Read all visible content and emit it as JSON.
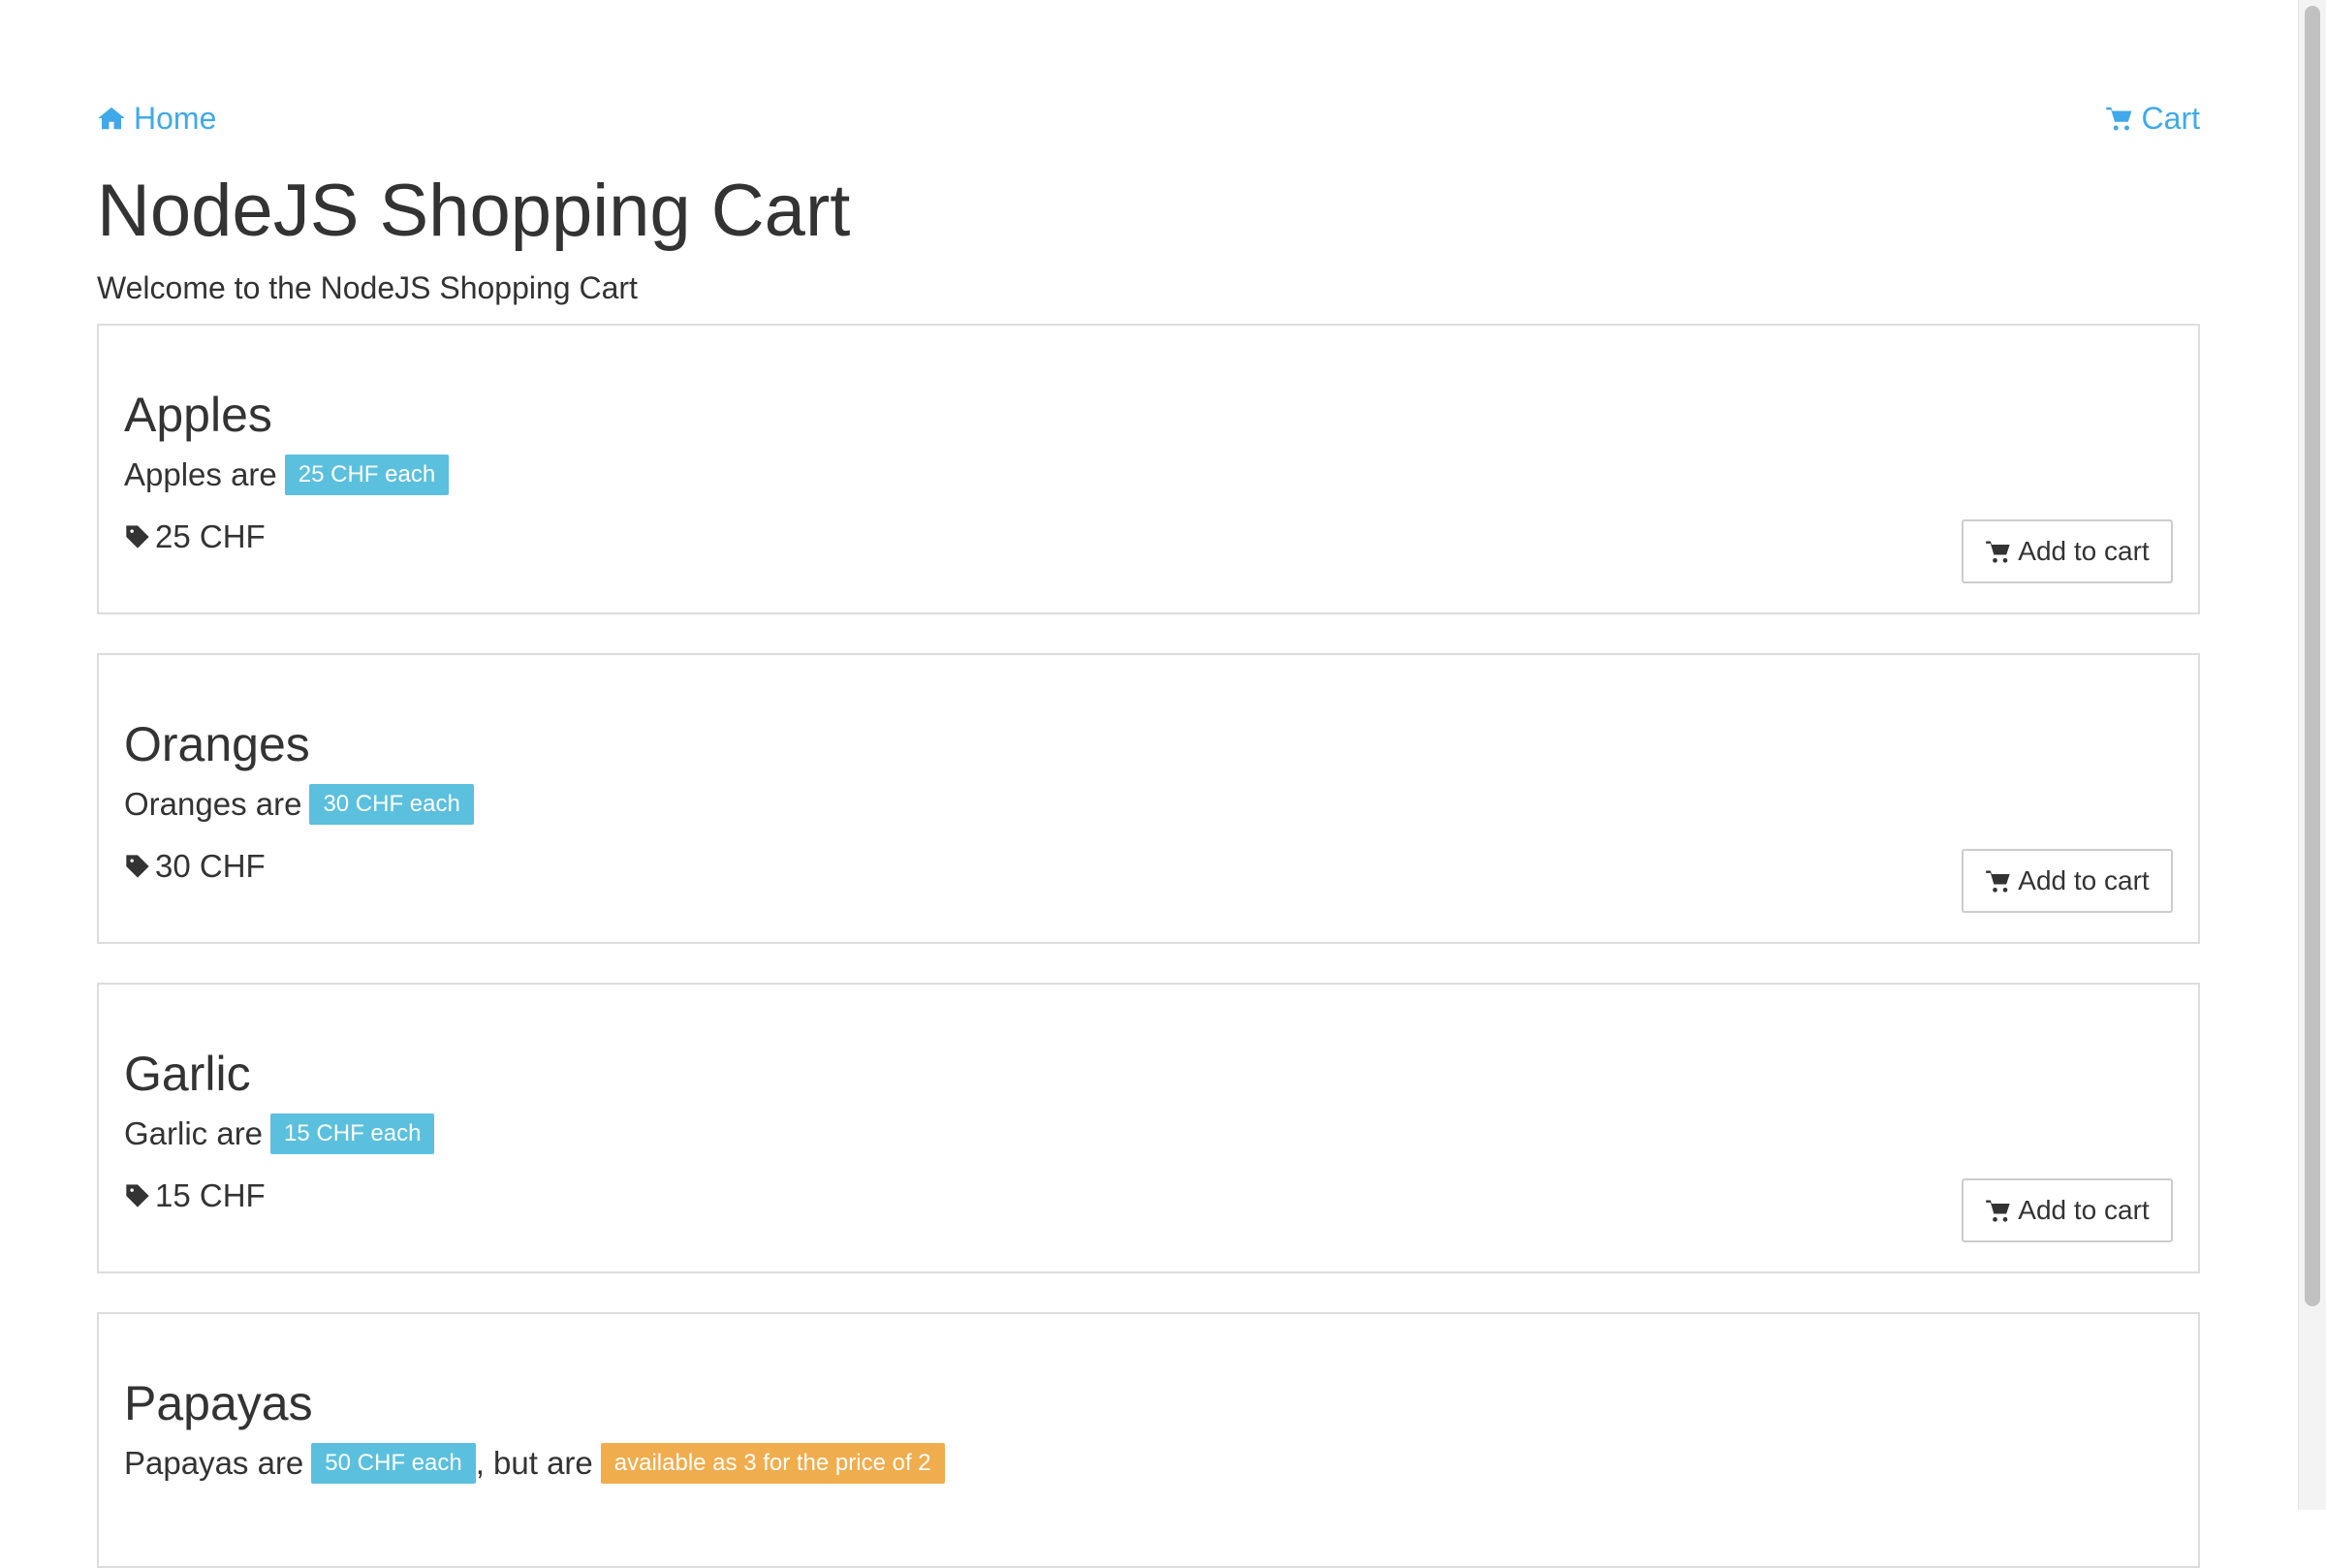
{
  "nav": {
    "home_label": "Home",
    "home_icon": "home-icon",
    "cart_label": "Cart",
    "cart_icon": "shopping-cart-icon",
    "link_color": "#40a9e8"
  },
  "header": {
    "title": "NodeJS Shopping Cart",
    "subtitle": "Welcome to the NodeJS Shopping Cart"
  },
  "products": [
    {
      "name": "Apples",
      "desc_prefix": "Apples are",
      "price_badge": "25 CHF each",
      "price": "25 CHF",
      "button": "Add to cart"
    },
    {
      "name": "Oranges",
      "desc_prefix": "Oranges are",
      "price_badge": "30 CHF each",
      "price": "30 CHF",
      "button": "Add to cart"
    },
    {
      "name": "Garlic",
      "desc_prefix": "Garlic are",
      "price_badge": "15 CHF each",
      "price": "15 CHF",
      "button": "Add to cart"
    },
    {
      "name": "Papayas",
      "desc_prefix": "Papayas are",
      "price_badge": "50 CHF each",
      "desc_middle": ", but are",
      "offer_badge": "available as 3 for the price of 2"
    }
  ],
  "colors": {
    "badge_info": "#5bc0de",
    "badge_warning": "#f0ad4e",
    "card_border": "#dddddd"
  }
}
